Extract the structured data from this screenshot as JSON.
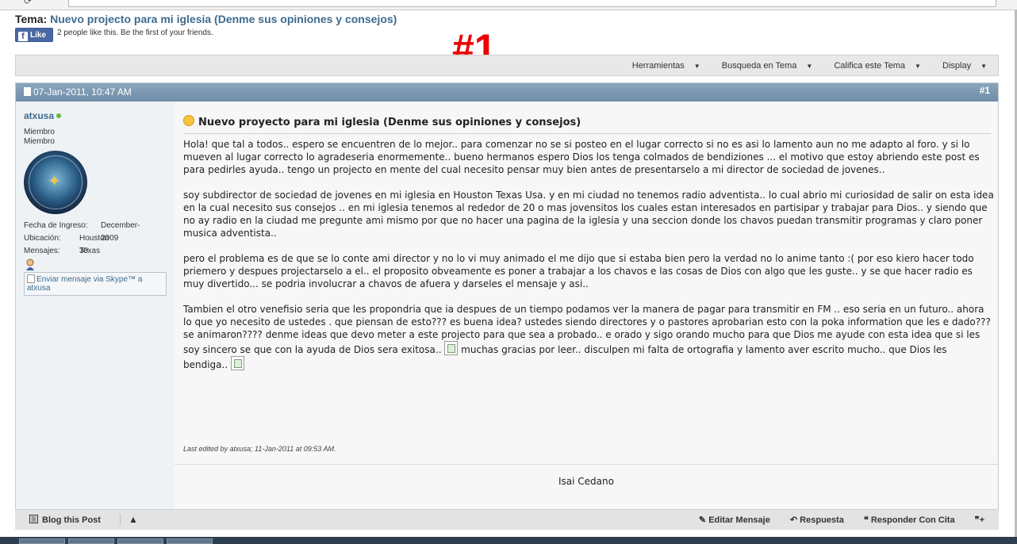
{
  "thread": {
    "title_prefix": "Tema:",
    "title": "Nuevo projecto para mi iglesia (Denme sus opiniones y consejos)"
  },
  "facebook": {
    "like_label": "Like",
    "like_text": "2 people like this. Be the first of your friends."
  },
  "overlay_label": "#1",
  "toolbar": {
    "items": [
      "Herramientas",
      "Busqueda en Tema",
      "Califica este Tema",
      "Display"
    ]
  },
  "post": {
    "date": "07-Jan-2011, 10:47 AM",
    "number": "#1",
    "user": {
      "name": "atxusa",
      "title1": "Miembro",
      "title2": "Miembro",
      "join_label": "Fecha de Ingreso:",
      "join_value": "December-2009",
      "location_label": "Ubicación:",
      "location_value": "Houston Texas",
      "posts_label": "Mensajes:",
      "posts_value": "30",
      "skype_alt": "Enviar mensaje via Skype™ a atxusa"
    },
    "title": "Nuevo proyecto para mi iglesia (Denme sus opiniones y consejos)",
    "paragraphs": [
      "Hola! que tal a todos.. espero se encuentren de lo mejor.. para comenzar no se si posteo en el lugar correcto si no es asi lo lamento aun no me adapto al foro. y si lo mueven al lugar correcto lo agradeseria enormemente.. bueno hermanos espero Dios los tenga colmados de bendiziones ... el motivo que estoy abriendo este post es para pedirles ayuda.. tengo un projecto en mente del cual necesito pensar muy bien antes de presentarselo a mi director de sociedad de jovenes..",
      "soy subdirector de sociedad de jovenes en mi iglesia en Houston Texas Usa. y en mi ciudad no tenemos radio adventista.. lo cual abrio mi curiosidad de salir on esta idea en la cual necesito sus consejos .. en mi iglesia tenemos al rededor de 20 o mas jovensitos los cuales estan interesados en partisipar y trabajar para Dios.. y siendo que no ay radio en la ciudad me pregunte ami mismo por que no hacer una pagina de la iglesia y una seccion donde los chavos puedan transmitir programas y claro poner musica adventista..",
      "pero el problema es de que se lo conte ami director y no lo vi muy animado el me dijo que si estaba bien pero la verdad no lo anime tanto :( por eso kiero hacer todo priemero y despues projectarselo a el.. el proposito obveamente es poner a trabajar a los chavos e las cosas de Dios con algo que les guste.. y se que hacer radio es muy divertido... se podria involucrar a chavos de afuera y darseles el mensaje y asi..",
      "Tambien el otro venefisio seria que les propondria que ia despues de un tiempo podamos ver la manera de pagar para transmitir en FM .. eso seria en un futuro.. ahora lo que yo necesito de ustedes . que piensan de esto??? es buena idea? ustedes siendo directores y o pastores aprobarian esto con la poka information que les e dado??? se animaron???? denme ideas que devo meter a este projecto para que sea a probado.. e orado y sigo orando mucho para que Dios me ayude con esta idea que si les soy sincero se que con la ayuda de Dios sera exitosa..",
      "muchas gracias por leer.. disculpen mi falta de ortografia y lamento aver escrito mucho.. que Dios les bendiga.."
    ],
    "last_edited": "Last edited by atxusa; 11-Jan-2011 at 09:53 AM.",
    "signature": "Isai Cedano"
  },
  "footer": {
    "blog": "Blog this Post",
    "edit": "Editar Mensaje",
    "reply": "Respuesta",
    "quote": "Responder Con Cita"
  }
}
